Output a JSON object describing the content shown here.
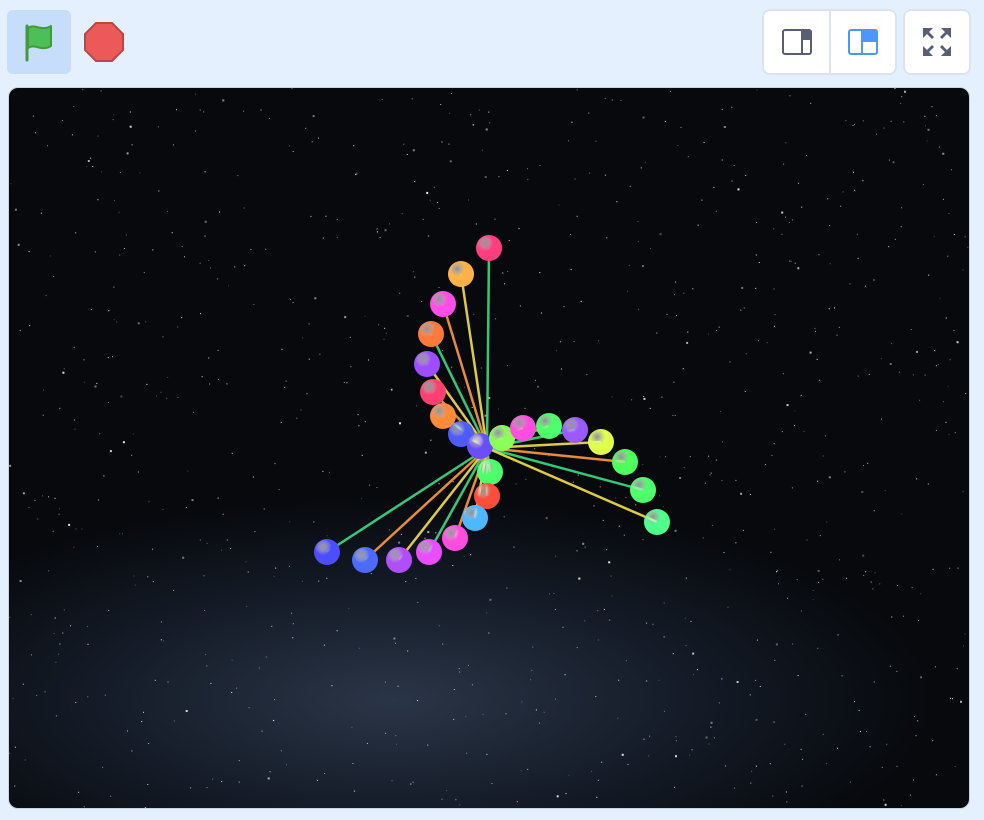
{
  "toolbar": {
    "green_flag": {
      "icon": "green-flag-icon",
      "color": "#4cbf56",
      "active": true
    },
    "stop": {
      "icon": "stop-sign-icon",
      "color": "#ec5959"
    },
    "stage_modes": [
      {
        "icon": "small-stage-icon",
        "selected": false
      },
      {
        "icon": "large-stage-icon",
        "selected": true,
        "color": "#4c97ff"
      }
    ],
    "fullscreen": {
      "icon": "fullscreen-icon"
    }
  },
  "stage": {
    "background": "starry-night-sky",
    "colors": {
      "accent": "#4c97ff",
      "lines": [
        "#3ddc84",
        "#f5e04a",
        "#ff9a3c"
      ]
    },
    "balls": [
      {
        "color": "#ff3d7f"
      },
      {
        "color": "#ffb347"
      },
      {
        "color": "#ff4de8"
      },
      {
        "color": "#ff7a3a"
      },
      {
        "color": "#9b4dff"
      },
      {
        "color": "#ff4070"
      },
      {
        "color": "#ff8a3a"
      },
      {
        "color": "#4d5bff"
      },
      {
        "color": "#6a4dff"
      },
      {
        "color": "#8aff5a"
      },
      {
        "color": "#ff4de0"
      },
      {
        "color": "#4dff6a"
      },
      {
        "color": "#9a5aff"
      },
      {
        "color": "#e0ff4d"
      },
      {
        "color": "#4dff5a"
      },
      {
        "color": "#4dff6a"
      },
      {
        "color": "#4dff8a"
      },
      {
        "color": "#4dff6a"
      },
      {
        "color": "#ff4d3a"
      },
      {
        "color": "#4db8ff"
      },
      {
        "color": "#ff4de0"
      },
      {
        "color": "#e84dff"
      },
      {
        "color": "#b24dff"
      },
      {
        "color": "#4d6aff"
      },
      {
        "color": "#4d4dff"
      }
    ]
  }
}
